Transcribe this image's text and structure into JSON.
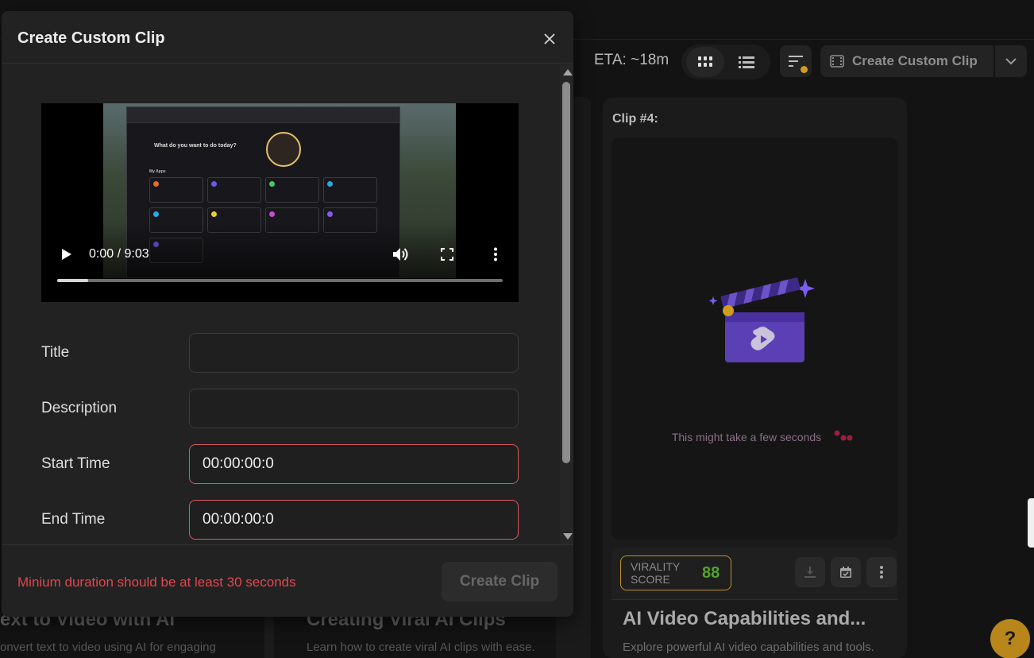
{
  "toolbar": {
    "eta": "ETA: ~18m",
    "create_custom_clip": "Create Custom Clip"
  },
  "clip_card": {
    "title": "Clip #4:",
    "loading_text": "This might take a few seconds",
    "virality_label_1": "VIRALITY",
    "virality_label_2": "SCORE",
    "virality_score": "88",
    "heading": "AI Video Capabilities and...",
    "subheading": "Explore powerful AI video capabilities and tools."
  },
  "bg_cards": {
    "left_heading": "ext to Video with AI",
    "left_sub": "onvert text to video using AI for engaging",
    "mid_heading": "Creating Viral AI Clips",
    "mid_sub": "Learn how to create viral AI clips with ease."
  },
  "help": {
    "label": "?"
  },
  "modal": {
    "title": "Create Custom Clip",
    "video": {
      "time": "0:00 / 9:03",
      "progress": 0.07,
      "greeting": "What do you want to do today?",
      "apps_label": "My Apps"
    },
    "fields": {
      "title_label": "Title",
      "title_value": "",
      "description_label": "Description",
      "description_value": "",
      "start_label": "Start Time",
      "start_value": "00:00:00:0",
      "end_label": "End Time",
      "end_value": "00:00:00:0"
    },
    "error": "Minium duration should be at least 30 seconds",
    "submit": "Create Clip"
  },
  "colors": {
    "accent_gold": "#d19b1d",
    "error_red": "#e2464e",
    "virality_green": "#53a32b",
    "clapper_purple": "#5b3fb5"
  },
  "icons": [
    "grid-view-icon",
    "list-view-icon",
    "sort-icon",
    "film-icon",
    "chevron-down-icon",
    "close-icon",
    "play-icon",
    "volume-icon",
    "fullscreen-icon",
    "more-vertical-icon",
    "download-icon",
    "calendar-icon",
    "clapperboard-icon"
  ]
}
